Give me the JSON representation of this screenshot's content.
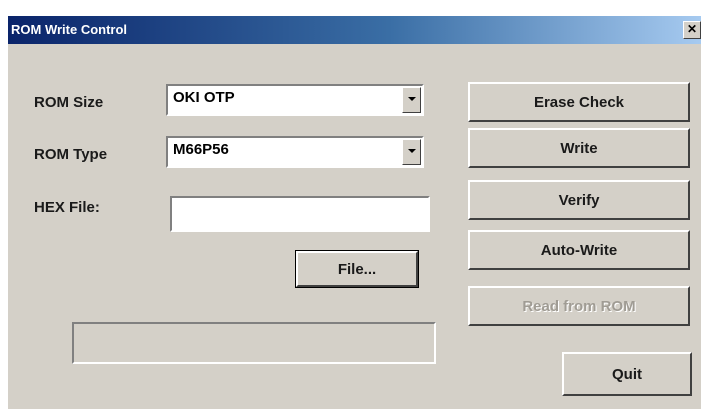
{
  "window": {
    "title": "ROM Write Control",
    "close_glyph": "✕"
  },
  "form": {
    "rom_size": {
      "label": "ROM Size",
      "value": "OKI OTP"
    },
    "rom_type": {
      "label": "ROM Type",
      "value": "M66P56"
    },
    "hex_file": {
      "label": "HEX File:",
      "value": ""
    },
    "file_button": "File..."
  },
  "actions": {
    "erase_check": "Erase Check",
    "write": "Write",
    "verify": "Verify",
    "auto_write": "Auto-Write",
    "read_from_rom": "Read from ROM",
    "quit": "Quit"
  },
  "progress": {
    "fraction": 0
  },
  "colors": {
    "face": "#d4d0c8",
    "title_start": "#0a246a",
    "title_end": "#a6caf0"
  }
}
